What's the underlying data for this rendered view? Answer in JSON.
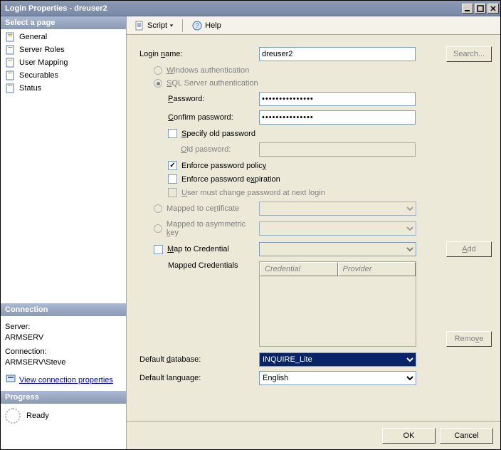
{
  "window": {
    "title": "Login Properties - dreuser2"
  },
  "toolbar": {
    "script_label": "Script",
    "help_label": "Help"
  },
  "sidebar": {
    "select_header": "Select a page",
    "pages": [
      {
        "label": "General"
      },
      {
        "label": "Server Roles"
      },
      {
        "label": "User Mapping"
      },
      {
        "label": "Securables"
      },
      {
        "label": "Status"
      }
    ],
    "connection_header": "Connection",
    "server_label": "Server:",
    "server_value": "ARMSERV",
    "connection_label": "Connection:",
    "connection_value": "ARMSERV\\Steve",
    "view_connection_props": "View connection properties",
    "progress_header": "Progress",
    "progress_status": "Ready"
  },
  "form": {
    "login_name_label": "Login name:",
    "login_name_value": "dreuser2",
    "search_btn": "Search...",
    "windows_auth": "Windows authentication",
    "sql_auth": "SQL Server authentication",
    "password_label": "Password:",
    "password_value": "•••••••••••••••",
    "confirm_password_label": "Confirm password:",
    "confirm_password_value": "•••••••••••••••",
    "specify_old_password": "Specify old password",
    "old_password_label": "Old password:",
    "enforce_policy": "Enforce password policy",
    "enforce_expiration": "Enforce password expiration",
    "must_change": "User must change password at next login",
    "mapped_to_cert": "Mapped to certificate",
    "mapped_to_asym": "Mapped to asymmetric key",
    "map_to_credential": "Map to Credential",
    "add_btn": "Add",
    "mapped_credentials": "Mapped Credentials",
    "cred_header_credential": "Credential",
    "cred_header_provider": "Provider",
    "remove_btn": "Remove",
    "default_db_label": "Default database:",
    "default_db_value": "INQUIRE_Lite",
    "default_lang_label": "Default language:",
    "default_lang_value": "English"
  },
  "buttons": {
    "ok": "OK",
    "cancel": "Cancel"
  }
}
